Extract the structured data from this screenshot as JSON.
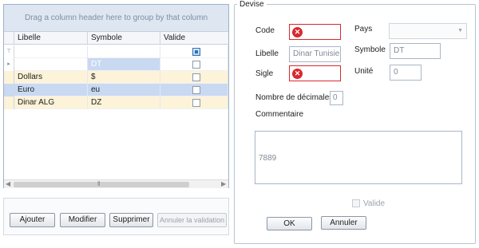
{
  "grid": {
    "group_hint": "Drag a column header here to group by that column",
    "columns": [
      "Libelle",
      "Symbole",
      "Valide"
    ],
    "filter_glyph": "filter-icon",
    "rows": [
      {
        "libelle": "",
        "symbole": "DT",
        "valide": false,
        "state": "new"
      },
      {
        "libelle": "Dollars",
        "symbole": "$",
        "valide": false,
        "state": "normal"
      },
      {
        "libelle": "Euro",
        "symbole": "eu",
        "valide": false,
        "state": "selected"
      },
      {
        "libelle": "Dinar ALG",
        "symbole": "DZ",
        "valide": false,
        "state": "normal"
      }
    ],
    "filter_row_checkbox": true
  },
  "actions": {
    "ajouter": "Ajouter",
    "modifier": "Modifier",
    "supprimer": "Supprimer",
    "annuler_validation": "Annuler la validation"
  },
  "form": {
    "legend": "Devise",
    "code_label": "Code",
    "code_value": "",
    "pays_label": "Pays",
    "pays_value": "",
    "libelle_label": "Libelle",
    "libelle_value": "Dinar Tunisien",
    "symbole_label": "Symbole",
    "symbole_value": "DT",
    "sigle_label": "Sigle",
    "sigle_value": "",
    "unite_label": "Unité",
    "unite_value": "0",
    "decimales_label": "Nombre de décimales",
    "decimales_value": "0",
    "commentaire_label": "Commentaire",
    "commentaire_value": "7889",
    "valide_label": "Valide",
    "ok_label": "OK",
    "annuler_label": "Annuler"
  },
  "colors": {
    "error": "#d9282e",
    "selected_row": "#c9d9f2",
    "alt_row": "#fdf3d8"
  }
}
